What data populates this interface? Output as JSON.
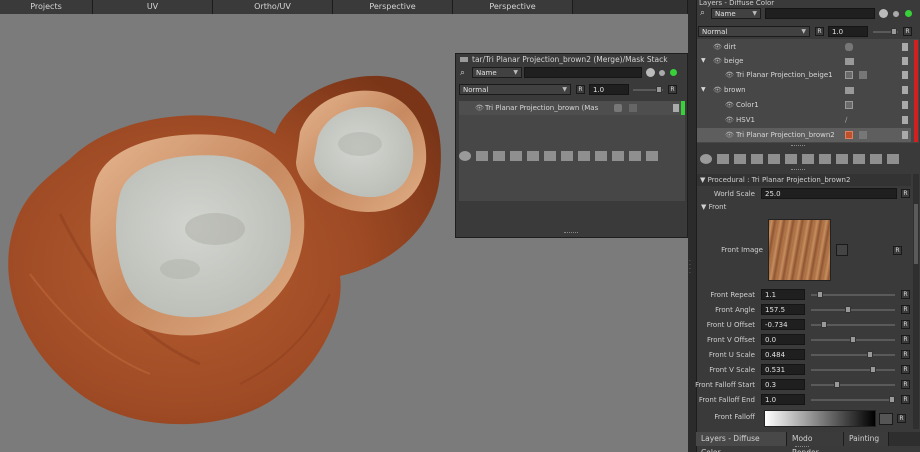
{
  "viewport_tabs": [
    "Projects",
    "UV",
    "Ortho/UV",
    "Perspective",
    "Perspective"
  ],
  "mask_panel": {
    "title": "tar/Tri Planar Projection_brown2 (Merge)/Mask Stack",
    "filter_mode": "Name",
    "blend_mode": "Normal",
    "opacity": "1.0",
    "layer": "Tri Planar Projection_brown (Mas",
    "r_label": "R"
  },
  "layers_panel": {
    "title": "Layers - Diffuse Color",
    "filter_mode": "Name",
    "blend_mode": "Normal",
    "opacity": "1.0",
    "r_label": "R",
    "items": [
      {
        "name": "dirt"
      },
      {
        "name": "beige"
      },
      {
        "name": "Tri Planar Projection_beige1"
      },
      {
        "name": "brown"
      },
      {
        "name": "Color1"
      },
      {
        "name": "HSV1"
      },
      {
        "name": "Tri Planar Projection_brown2"
      }
    ]
  },
  "properties": {
    "section_title": "Procedural : Tri Planar Projection_brown2",
    "world_scale_label": "World Scale",
    "world_scale_value": "25.0",
    "front_label": "Front",
    "front_image_label": "Front Image",
    "rows": [
      {
        "label": "Front Repeat",
        "value": "1.1",
        "slider": 0.08
      },
      {
        "label": "Front Angle",
        "value": "157.5",
        "slider": 0.44
      },
      {
        "label": "Front U Offset",
        "value": "-0.734",
        "slider": 0.13
      },
      {
        "label": "Front V Offset",
        "value": "0.0",
        "slider": 0.5
      },
      {
        "label": "Front U Scale",
        "value": "0.484",
        "slider": 0.72
      },
      {
        "label": "Front V Scale",
        "value": "0.531",
        "slider": 0.75
      },
      {
        "label": "Front Falloff Start",
        "value": "0.3",
        "slider": 0.3
      },
      {
        "label": "Front Falloff End",
        "value": "1.0",
        "slider": 1.0
      }
    ],
    "front_falloff_label": "Front Falloff"
  },
  "bottom_tabs": [
    "Layers - Diffuse Color",
    "Modo Render",
    "Painting"
  ],
  "colors": {
    "viewport_bg": "#7b7b7b",
    "wood": "#a3502a",
    "rim": "#d9a27a",
    "top_face": "#c9cbc6",
    "selection_red": "#d21f1f",
    "active_green": "#39d13a"
  }
}
